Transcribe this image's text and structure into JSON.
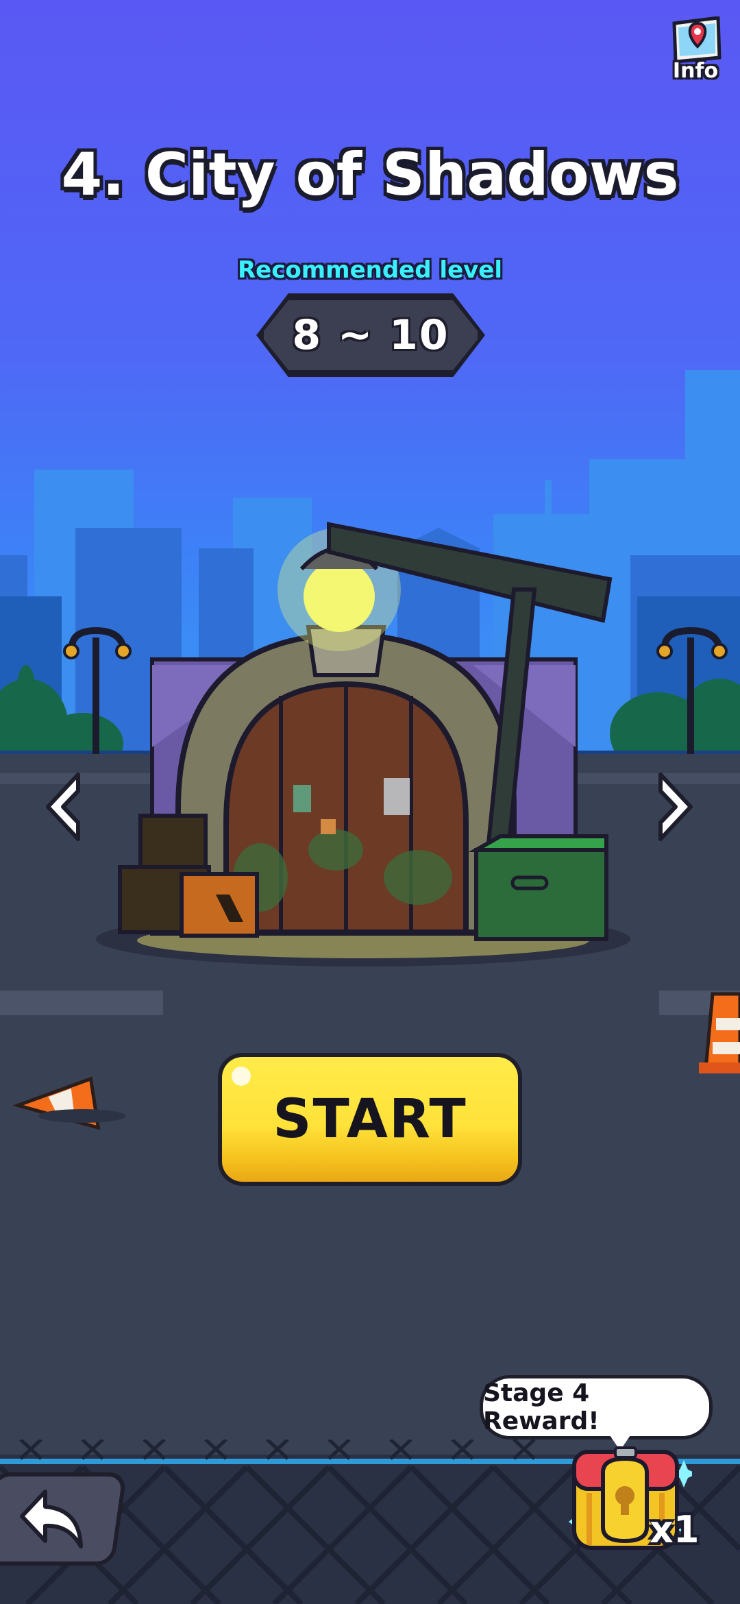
{
  "header": {
    "info_label": "Info",
    "info_icon": "map-pin-icon"
  },
  "stage": {
    "title": "4. City of Shadows",
    "recommended_label": "Recommended level",
    "recommended_range": "8 ~ 10"
  },
  "navigation": {
    "prev_icon": "chevron-left-icon",
    "next_icon": "chevron-right-icon",
    "back_icon": "back-arrow-icon"
  },
  "actions": {
    "start_label": "START"
  },
  "reward": {
    "bubble_text": "Stage 4 Reward!",
    "count": "x1",
    "icon": "treasure-chest-icon"
  },
  "colors": {
    "sky_top": "#5a58f4",
    "road": "#394155",
    "accent_cyan": "#39f0ff",
    "start_yellow": "#ffe23a"
  }
}
